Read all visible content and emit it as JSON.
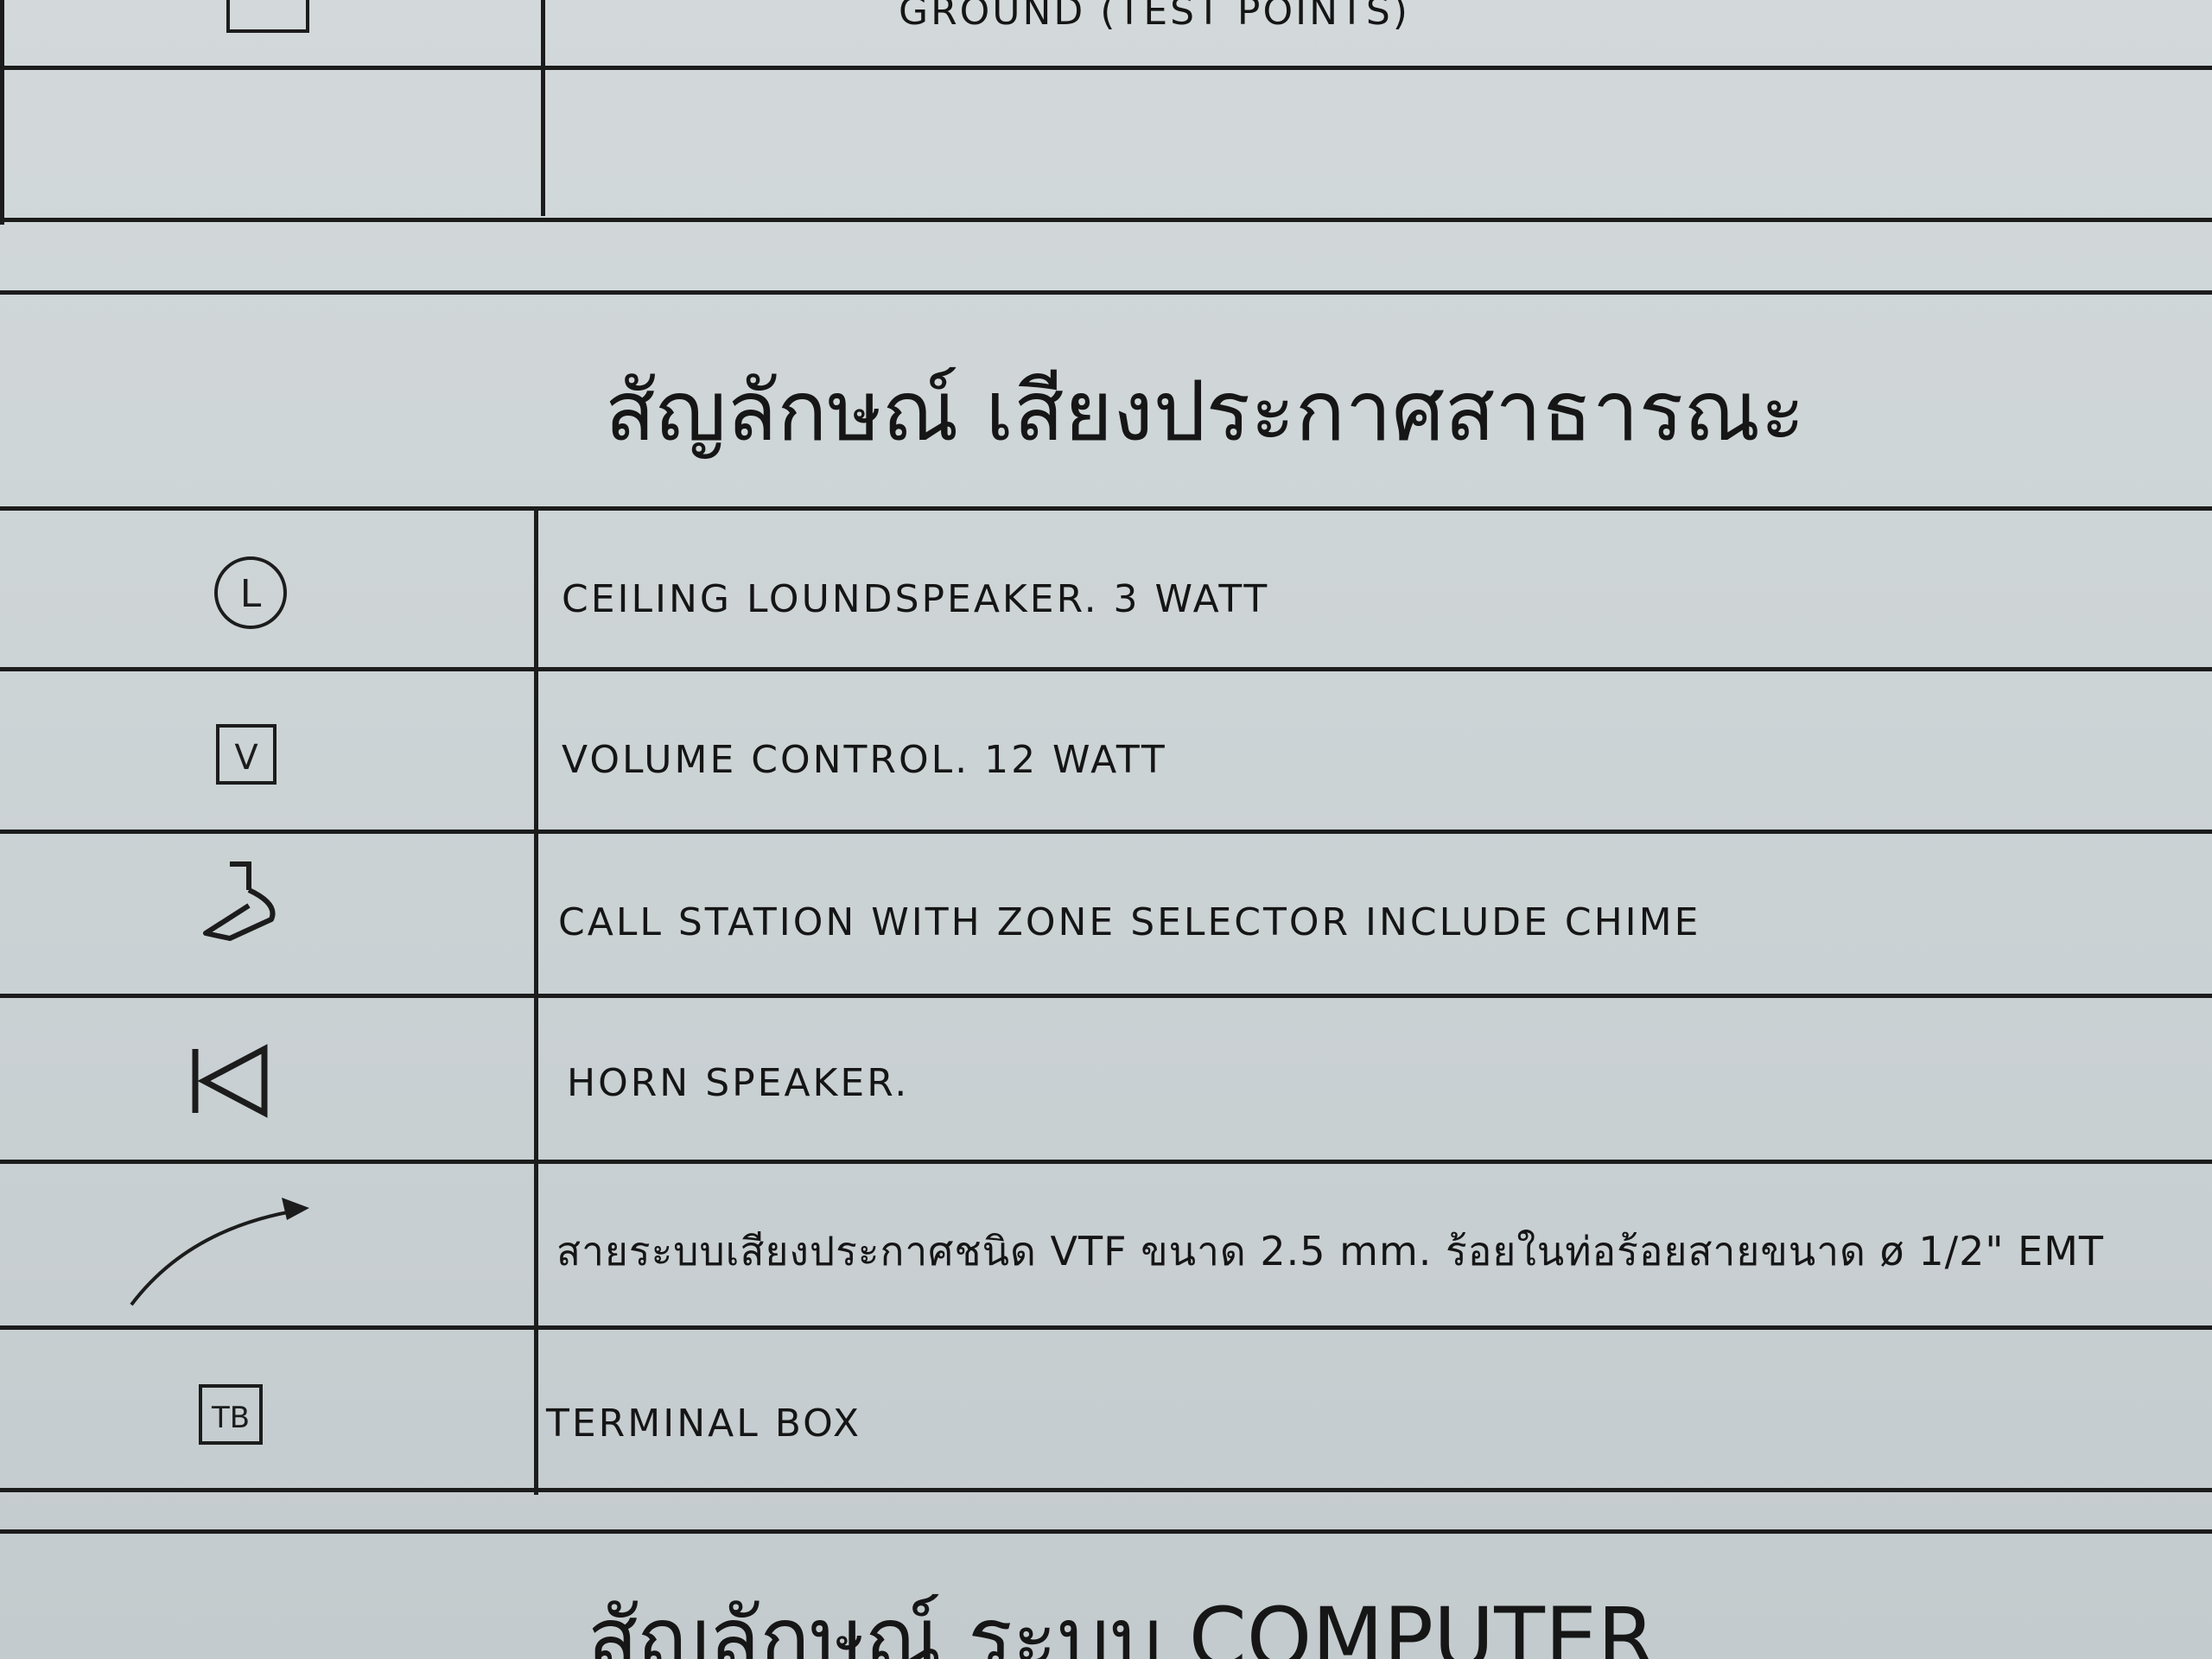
{
  "top_partial_row": {
    "description": "GROUND (TEST POINTS)"
  },
  "section_title": "สัญลักษณ์ เสียงประกาศสาธารณะ",
  "legend_rows": [
    {
      "symbol": "ceiling-speaker-icon",
      "symbol_letter": "L",
      "description": "CEILING LOUNDSPEAKER. 3 WATT"
    },
    {
      "symbol": "volume-control-icon",
      "symbol_letter": "V",
      "description": "VOLUME CONTROL. 12 WATT"
    },
    {
      "symbol": "call-station-icon",
      "description": "CALL STATION WITH ZONE SELECTOR INCLUDE CHIME"
    },
    {
      "symbol": "horn-speaker-icon",
      "description": "HORN SPEAKER."
    },
    {
      "symbol": "cable-arrow-icon",
      "description": "สายระบบเสียงประกาศชนิด VTF ขนาด 2.5 mm. ร้อยในท่อร้อยสายขนาด ø 1/2\" EMT"
    },
    {
      "symbol": "terminal-box-icon",
      "symbol_letter": "TB",
      "description": "TERMINAL BOX"
    }
  ],
  "next_section_title": "สัญลักษณ์ ระบบ COMPUTER"
}
